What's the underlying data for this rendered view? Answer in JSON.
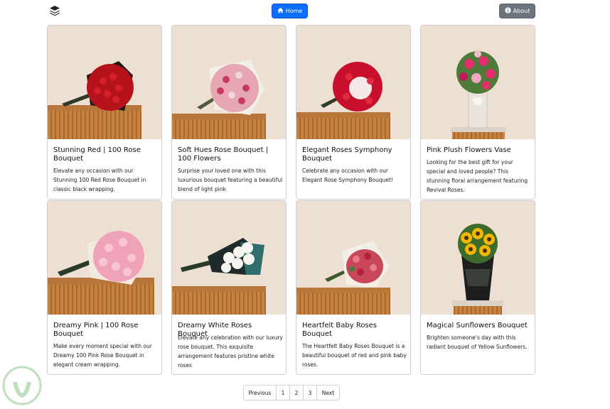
{
  "nav": {
    "home_label": "Home",
    "about_label": "About",
    "logo_icon": "layers-icon",
    "home_icon": "house-icon",
    "about_icon": "info-circle-icon",
    "home_color": "#0d6efd",
    "about_color": "#6c757d"
  },
  "products": [
    {
      "title": "Stunning Red | 100 Rose Bouquet",
      "description": "Elevate any occasion with our Stunning 100 Red Rose Bouquet in classic black wrapping."
    },
    {
      "title": "Soft Hues Rose Bouquet | 100 Flowers",
      "description": "Surprise your loved one with this luxurious bouquet featuring a beautiful blend of light pink"
    },
    {
      "title": "Elegant Roses Symphony Bouquet",
      "description": "Celebrate any occasion with our Elegant Rose Symphony Bouquet!"
    },
    {
      "title": "Pink Plush Flowers Vase",
      "description": "Looking for the best gift for your special and loved people? This stunning floral arrangement featuring Revival Roses."
    },
    {
      "title": "Dreamy Pink | 100 Rose Bouquet",
      "description": "Make every moment special with our Dreamy 100 Pink Rose Bouquet in elegant cream wrapping."
    },
    {
      "title": "Dreamy White Roses Bouquet",
      "description": "Elevate any celebration with our luxury rose bouquet. This exquisite arrangement features pristine white roses"
    },
    {
      "title": "Heartfelt Baby Roses Bouquet",
      "description": "The Heartfelt Baby Roses Bouquet is a beautiful bouquet of red and pink baby roses."
    },
    {
      "title": "Magical Sunflowers Bouquet",
      "description": "Brighten someone's day with this radiant bouquet of Yellow Sunflowers."
    }
  ],
  "pagination": {
    "previous": "Previous",
    "pages": [
      "1",
      "2",
      "3"
    ],
    "next": "Next"
  }
}
